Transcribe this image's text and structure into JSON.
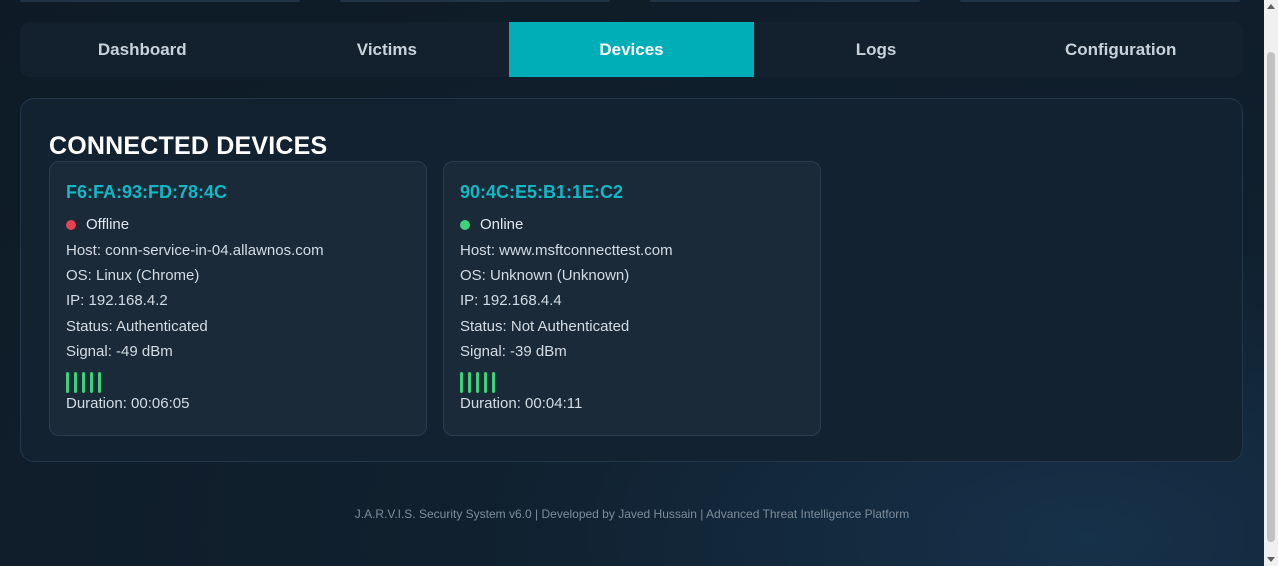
{
  "tabs": [
    {
      "label": "Dashboard",
      "active": false
    },
    {
      "label": "Victims",
      "active": false
    },
    {
      "label": "Devices",
      "active": true
    },
    {
      "label": "Logs",
      "active": false
    },
    {
      "label": "Configuration",
      "active": false
    }
  ],
  "section_title": "CONNECTED DEVICES",
  "devices": [
    {
      "mac": "F6:FA:93:FD:78:4C",
      "state": "Offline",
      "state_color": "#e8414f",
      "host": "Host: conn-service-in-04.allawnos.com",
      "os": "OS: Linux (Chrome)",
      "ip": "IP: 192.168.4.2",
      "status": "Status: Authenticated",
      "signal": "Signal: -49 dBm",
      "signal_bars": 5,
      "duration": "Duration: 00:06:05"
    },
    {
      "mac": "90:4C:E5:B1:1E:C2",
      "state": "Online",
      "state_color": "#3ed07a",
      "host": "Host: www.msftconnecttest.com",
      "os": "OS: Unknown (Unknown)",
      "ip": "IP: 192.168.4.4",
      "status": "Status: Not Authenticated",
      "signal": "Signal: -39 dBm",
      "signal_bars": 5,
      "duration": "Duration: 00:04:11"
    }
  ],
  "footer": "J.A.R.V.I.S. Security System v6.0 | Developed by Javed Hussain | Advanced Threat Intelligence Platform",
  "colors": {
    "accent": "#00aeb8",
    "mac_text": "#14b8c4",
    "signal_bar": "#3ed07a"
  }
}
